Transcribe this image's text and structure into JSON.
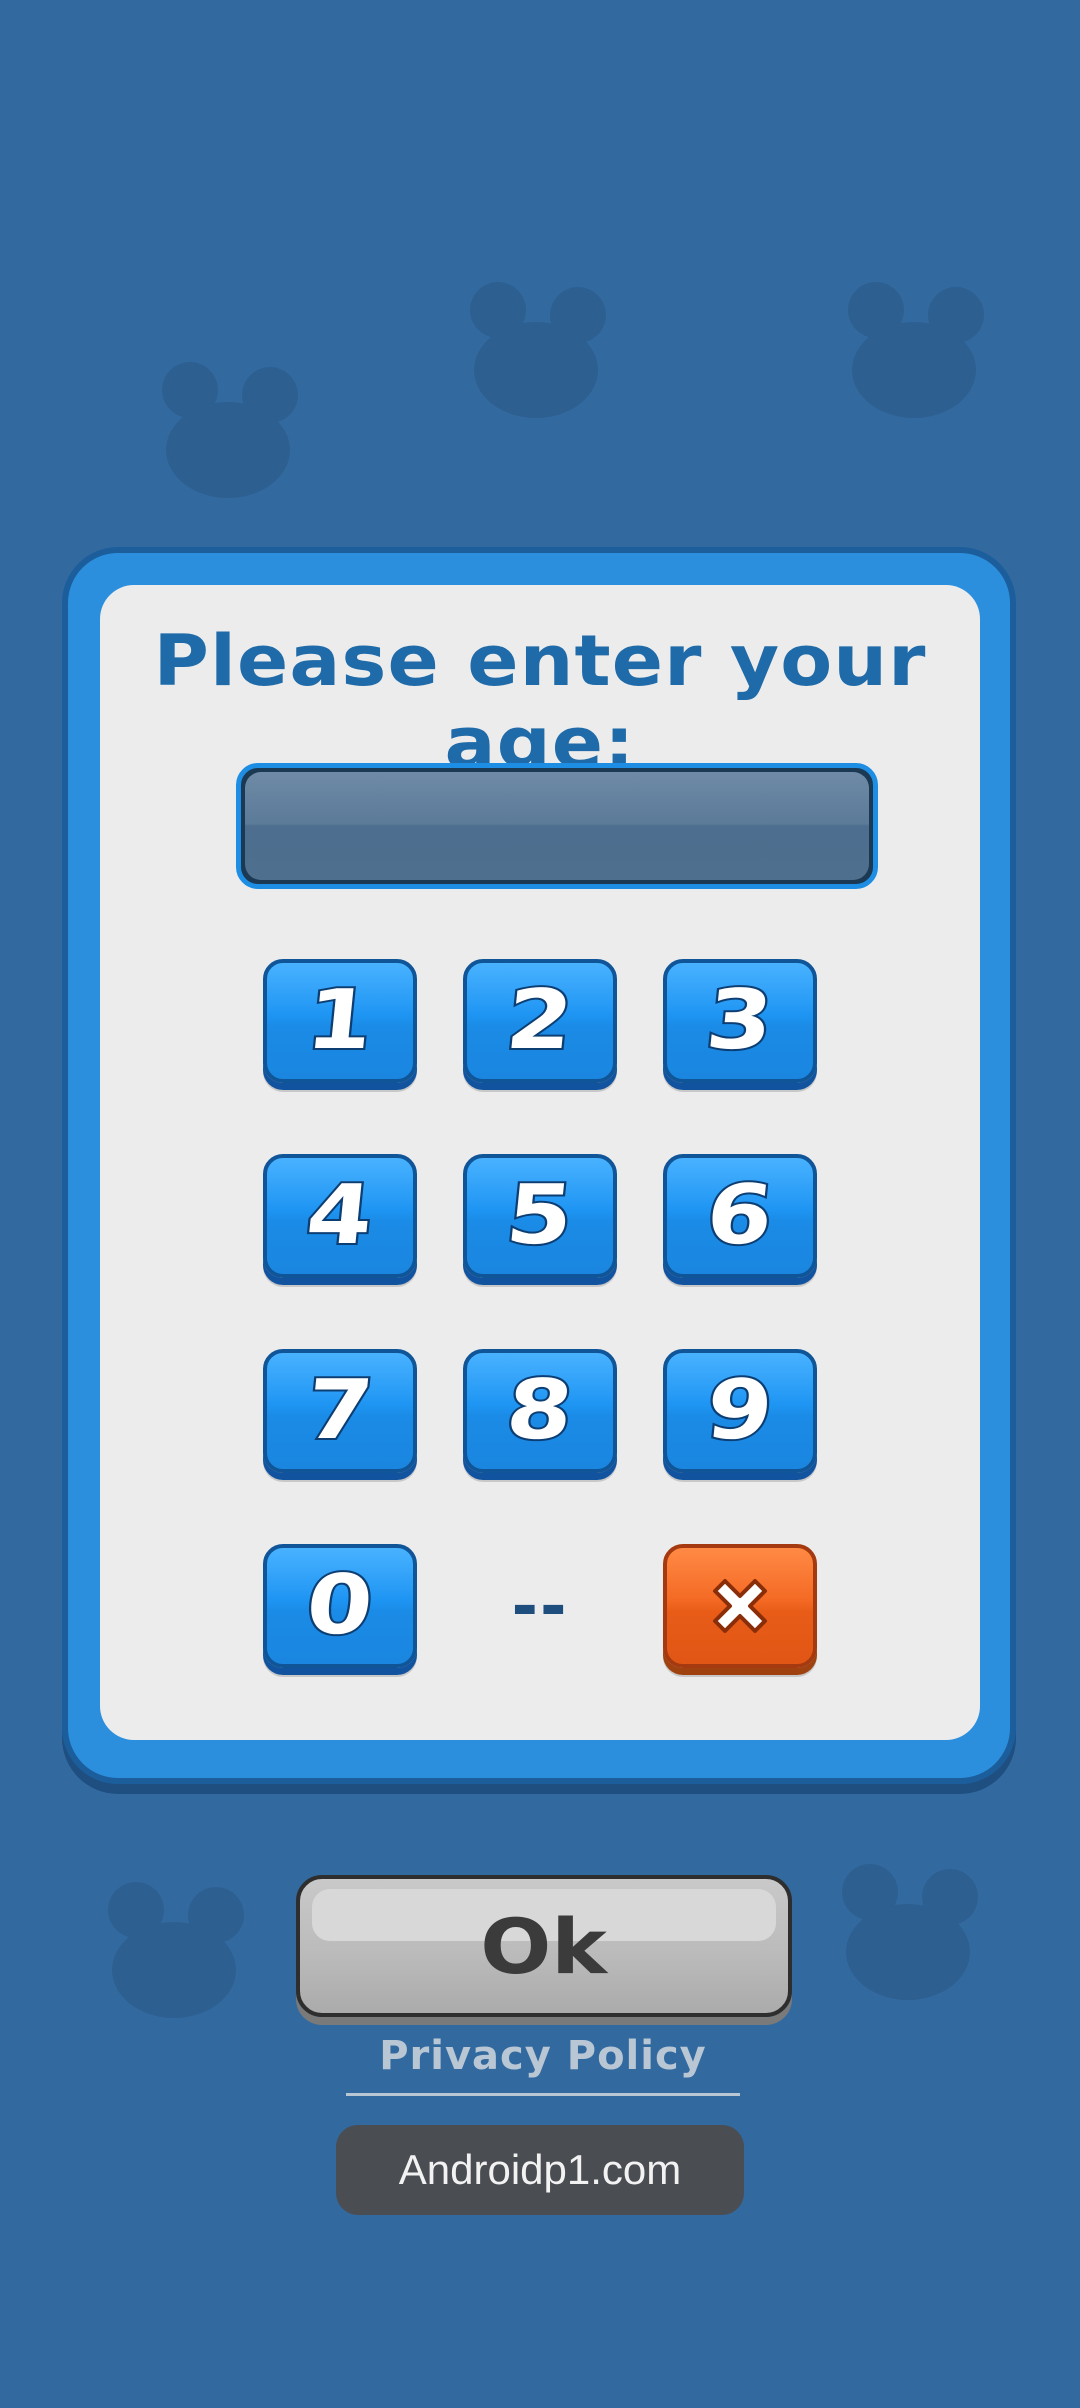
{
  "dialog": {
    "title": "Please enter your age:",
    "display_value": "",
    "keypad": {
      "keys": [
        "1",
        "2",
        "3",
        "4",
        "5",
        "6",
        "7",
        "8",
        "9",
        "0"
      ],
      "separator": "--",
      "delete_icon": "close-x-icon"
    }
  },
  "ok_button": {
    "label": "Ok"
  },
  "privacy_link": {
    "label": "Privacy Policy"
  },
  "watermark": {
    "text": "Androidp1.com"
  },
  "colors": {
    "background": "#326aa0",
    "frame_blue": "#2c8fdd",
    "key_blue": "#1e95f3",
    "delete_orange": "#f46a24",
    "title_blue": "#1f6aa8",
    "ok_gray": "#bbbbbb"
  }
}
